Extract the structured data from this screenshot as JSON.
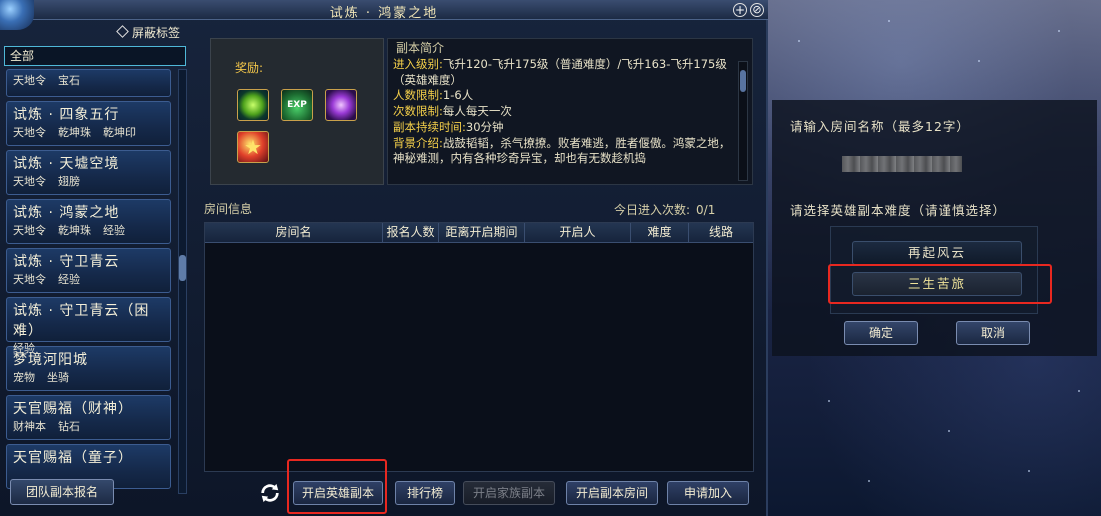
{
  "window": {
    "title": "试炼 · 鸿蒙之地",
    "add_icon": "plus-icon",
    "close_icon": "no-entry-icon"
  },
  "sidebar": {
    "hide_tabs_label": "屏蔽标签",
    "filter_value": "全部",
    "items": [
      {
        "name": "",
        "tags": [
          "天地令",
          "宝石"
        ]
      },
      {
        "name": "试炼 · 四象五行",
        "tags": [
          "天地令",
          "乾坤珠",
          "乾坤印"
        ]
      },
      {
        "name": "试炼 · 天墟空境",
        "tags": [
          "天地令",
          "翅膀"
        ]
      },
      {
        "name": "试炼 · 鸿蒙之地",
        "tags": [
          "天地令",
          "乾坤珠",
          "经验"
        ]
      },
      {
        "name": "试炼 · 守卫青云",
        "tags": [
          "天地令",
          "经验"
        ]
      },
      {
        "name": "试炼 · 守卫青云（困难）",
        "tags": [
          "经验"
        ]
      },
      {
        "name": "梦境河阳城",
        "tags": [
          "宠物",
          "坐骑"
        ]
      },
      {
        "name": "天官赐福（财神）",
        "tags": [
          "财神本",
          "钻石"
        ]
      },
      {
        "name": "天官赐福（童子）",
        "tags": []
      }
    ],
    "team_signup_label": "团队副本报名"
  },
  "rewards": {
    "label": "奖励:",
    "icons": [
      "green-orb-icon",
      "exp-icon",
      "purple-orb-icon",
      "red-star-icon"
    ],
    "exp_text": "EXP"
  },
  "intro": {
    "heading": "副本简介",
    "lines": [
      {
        "label": "进入级别:",
        "text": "飞升120-飞升175级（普通难度）/飞升163-飞升175级（英雄难度）"
      },
      {
        "label": "人数限制:",
        "text": "1-6人"
      },
      {
        "label": "次数限制:",
        "text": "每人每天一次"
      },
      {
        "label": "副本持续时间:",
        "text": "30分钟"
      },
      {
        "label": "背景介绍:",
        "text": "战鼓韬韬，杀气撩撩。败者难逃，胜者偃傲。鸿蒙之地，神秘难测，内有各种珍奇异宝，却也有无数趁机捣"
      }
    ]
  },
  "rooms": {
    "heading": "房间信息",
    "entries_label": "今日进入次数:",
    "entries_value": "0/1",
    "columns": [
      "房间名",
      "报名人数",
      "距离开启期间",
      "开启人",
      "难度",
      "线路"
    ],
    "rows": []
  },
  "actions": {
    "refresh_icon": "refresh-icon",
    "open_hero": "开启英雄副本",
    "leaderboard": "排行榜",
    "open_family": "开启家族副本",
    "open_room": "开启副本房间",
    "apply_join": "申请加入"
  },
  "dialog": {
    "room_name_prompt": "请输入房间名称（最多12字）",
    "room_name_value": "",
    "difficulty_prompt": "请选择英雄副本难度（请谨慎选择）",
    "options": [
      "再起风云",
      "三生苦旅"
    ],
    "selected_option": "三生苦旅",
    "confirm": "确定",
    "cancel": "取消"
  },
  "colors": {
    "accent_gold": "#f5d04a",
    "highlight_red": "#e82820",
    "panel_blue": "#15294a"
  }
}
